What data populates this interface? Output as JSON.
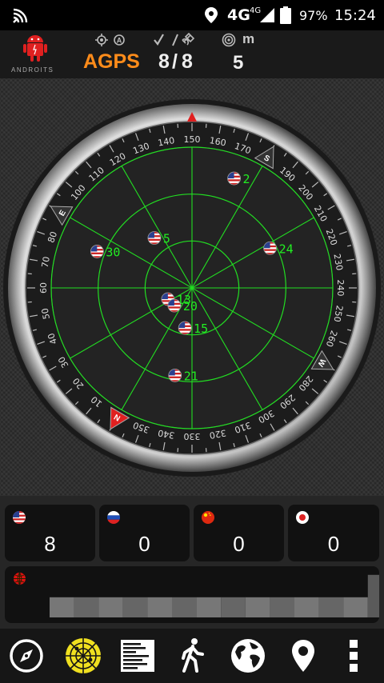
{
  "status": {
    "network": "4G",
    "network_sup": "4G",
    "battery": "97%",
    "time": "15:24"
  },
  "header": {
    "logo_text": "ANDROITS",
    "mode": "AGPS",
    "sats_used": "8",
    "sats_sep": "/",
    "sats_total": "8",
    "accuracy_unit": "m",
    "accuracy": "5"
  },
  "radar": {
    "labels": [
      "N",
      "E",
      "S",
      "W"
    ],
    "satellites": [
      {
        "id": "2",
        "az": 171,
        "el": 15
      },
      {
        "id": "24",
        "az": 213,
        "el": 34
      },
      {
        "id": "5",
        "az": 113,
        "el": 50
      },
      {
        "id": "13",
        "az": 35,
        "el": 73
      },
      {
        "id": "20",
        "az": 15,
        "el": 74
      },
      {
        "id": "15",
        "az": 340,
        "el": 64
      },
      {
        "id": "30",
        "az": 81,
        "el": 25
      },
      {
        "id": "21",
        "az": 341,
        "el": 33
      }
    ]
  },
  "constellations": [
    {
      "name": "usa-flag-icon",
      "count": "8"
    },
    {
      "name": "russia-flag-icon",
      "count": "0"
    },
    {
      "name": "china-flag-icon",
      "count": "0"
    },
    {
      "name": "japan-flag-icon",
      "count": "0"
    }
  ],
  "signal_bars": [
    0.45,
    0.45,
    0.45,
    0.45,
    0.45,
    0.45,
    0.45,
    0.45,
    0.45,
    0.45,
    0.45,
    0.45,
    0.45,
    0.95
  ],
  "nav": [
    "compass-icon",
    "radar-icon",
    "signal-list-icon",
    "walk-icon",
    "globe-icon",
    "location-pin-icon",
    "more-vert-icon"
  ],
  "colors": {
    "accent": "#ff8c1a",
    "radar_green": "#22dd22",
    "marker_red": "#e02020"
  }
}
